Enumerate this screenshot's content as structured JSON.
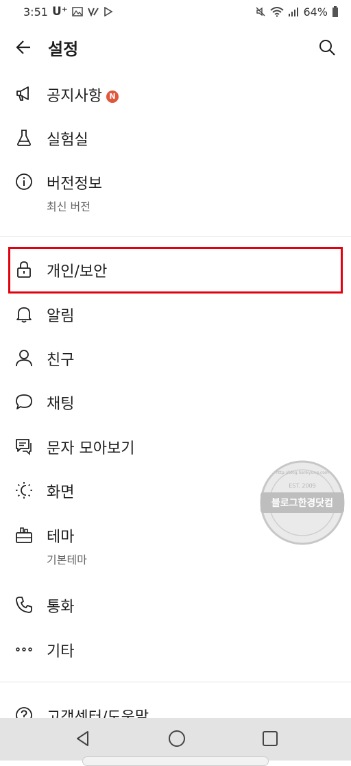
{
  "status": {
    "time": "3:51",
    "carrier": "U⁺",
    "battery": "64%"
  },
  "header": {
    "title": "설정"
  },
  "menu": {
    "notice": {
      "label": "공지사항",
      "badge": "N"
    },
    "lab": {
      "label": "실험실"
    },
    "version": {
      "label": "버전정보",
      "sub": "최신 버전"
    },
    "privacy": {
      "label": "개인/보안"
    },
    "alarm": {
      "label": "알림"
    },
    "friends": {
      "label": "친구"
    },
    "chat": {
      "label": "채팅"
    },
    "sms": {
      "label": "문자 모아보기"
    },
    "display": {
      "label": "화면"
    },
    "theme": {
      "label": "테마",
      "sub": "기본테마"
    },
    "call": {
      "label": "통화"
    },
    "etc": {
      "label": "기타"
    },
    "help": {
      "label": "고객센터/도움말"
    }
  },
  "watermark": {
    "main": "블로그한경닷컴",
    "est": "EST. 2009",
    "url": "http://blog.hankyung.com"
  },
  "colors": {
    "highlight": "#e3000f",
    "badge": "#e0573c"
  }
}
